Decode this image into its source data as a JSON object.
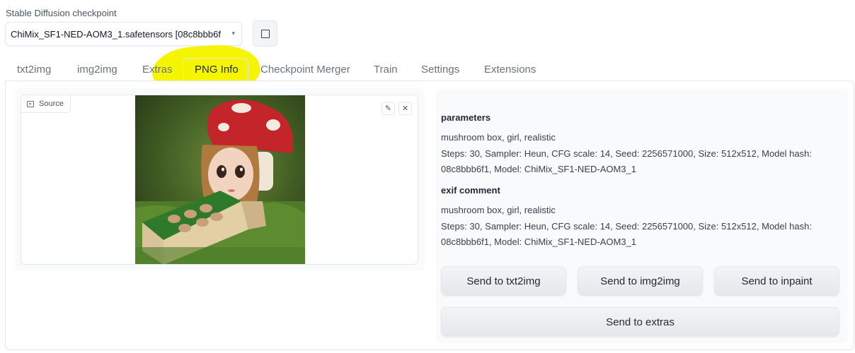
{
  "checkpoint": {
    "label": "Stable Diffusion checkpoint",
    "value": "ChiMix_SF1-NED-AOM3_1.safetensors [08c8bbb6f",
    "caret": "▾"
  },
  "tabs": [
    "txt2img",
    "img2img",
    "Extras",
    "PNG Info",
    "Checkpoint Merger",
    "Train",
    "Settings",
    "Extensions"
  ],
  "active_tab": "PNG Info",
  "highlight_color": "#f5f500",
  "image": {
    "source_label": "Source",
    "edit_icon": "✎",
    "close_icon": "✕"
  },
  "info": {
    "parameters_heading": "parameters",
    "parameters_prompt": "mushroom box, girl, realistic",
    "parameters_settings_1": "Steps: 30, Sampler: Heun, CFG scale: 14, Seed: 2256571000, Size: 512x512, Model hash:",
    "parameters_settings_2": "08c8bbb6f1, Model: ChiMix_SF1-NED-AOM3_1",
    "exif_heading": "exif comment",
    "exif_prompt": "mushroom box, girl, realistic",
    "exif_settings_1": "Steps: 30, Sampler: Heun, CFG scale: 14, Seed: 2256571000, Size: 512x512, Model hash:",
    "exif_settings_2": "08c8bbb6f1, Model: ChiMix_SF1-NED-AOM3_1"
  },
  "buttons": {
    "send_txt2img": "Send to txt2img",
    "send_img2img": "Send to img2img",
    "send_inpaint": "Send to inpaint",
    "send_extras": "Send to extras"
  }
}
